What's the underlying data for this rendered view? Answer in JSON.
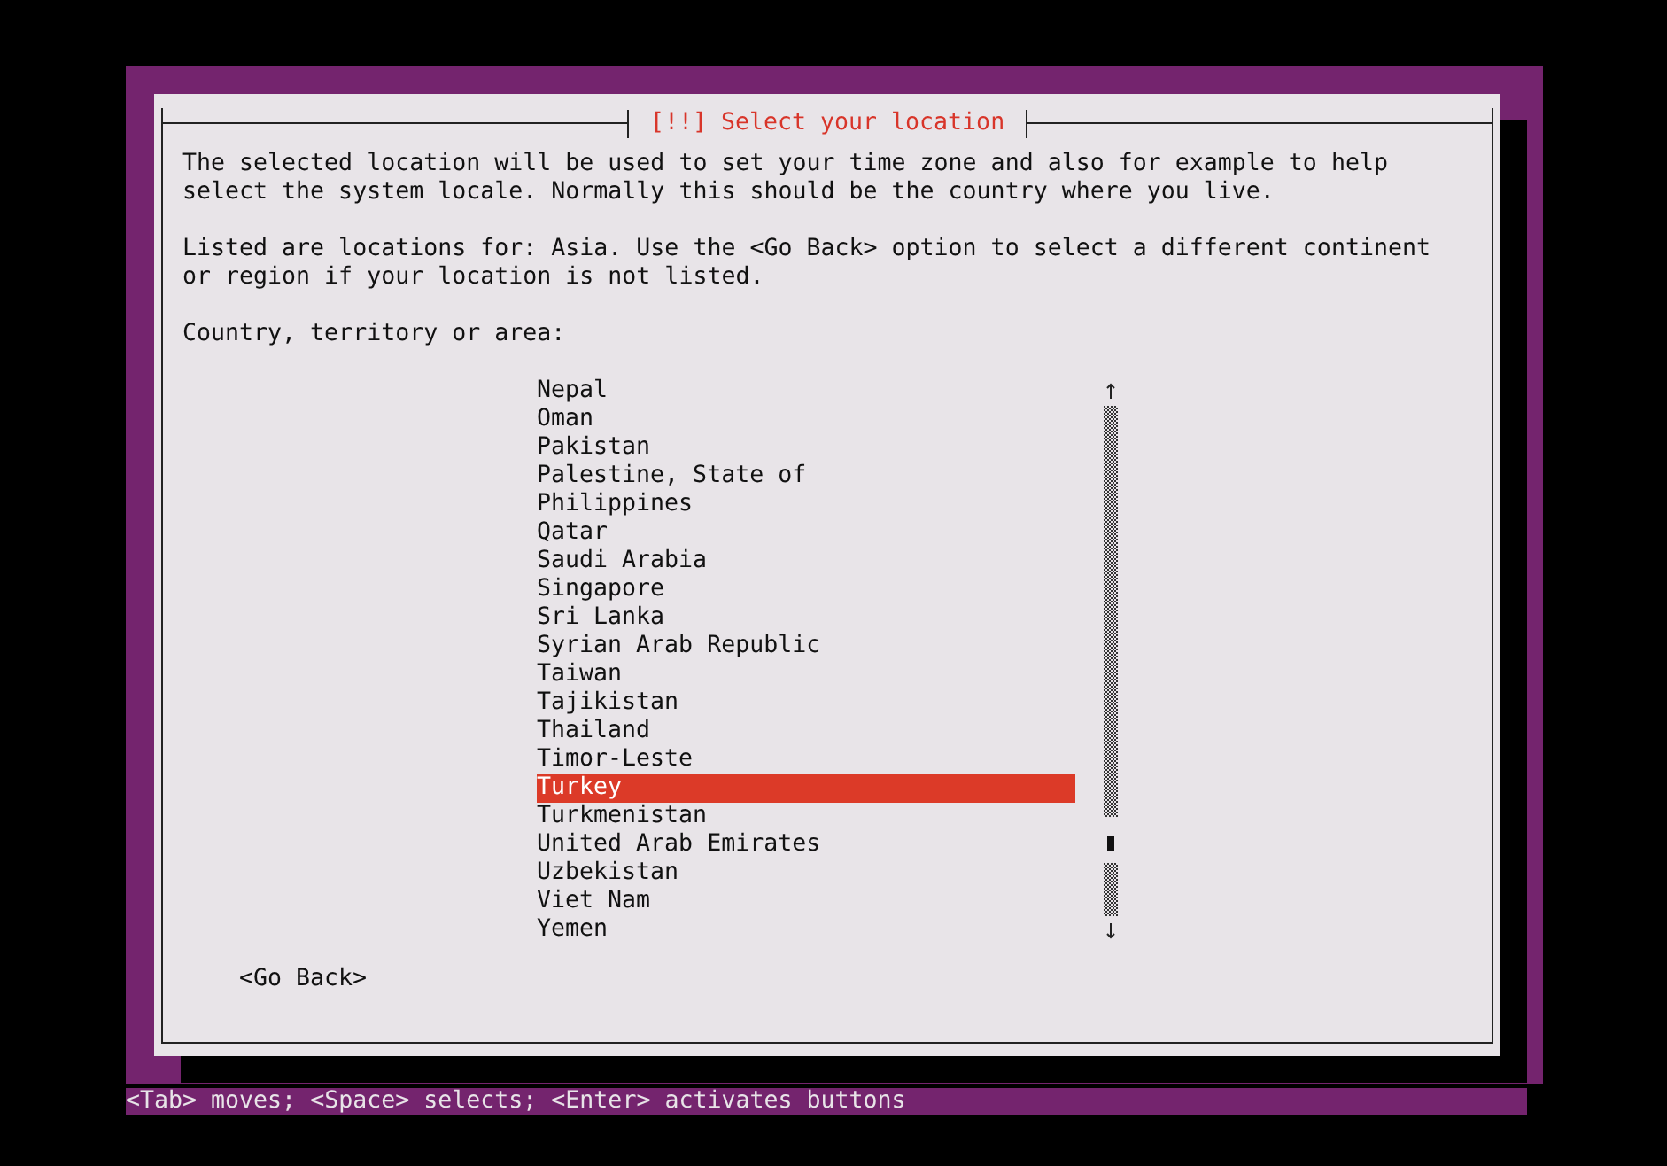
{
  "dialog": {
    "title": "[!!] Select your location",
    "paragraphs": [
      "The selected location will be used to set your time zone and also for example to help select the system locale. Normally this should be the country where you live.",
      "Listed are locations for: Asia. Use the <Go Back> option to select a different continent or region if your location is not listed."
    ],
    "list_label": "Country, territory or area:",
    "items": [
      {
        "label": "Nepal",
        "selected": false
      },
      {
        "label": "Oman",
        "selected": false
      },
      {
        "label": "Pakistan",
        "selected": false
      },
      {
        "label": "Palestine, State of",
        "selected": false
      },
      {
        "label": "Philippines",
        "selected": false
      },
      {
        "label": "Qatar",
        "selected": false
      },
      {
        "label": "Saudi Arabia",
        "selected": false
      },
      {
        "label": "Singapore",
        "selected": false
      },
      {
        "label": "Sri Lanka",
        "selected": false
      },
      {
        "label": "Syrian Arab Republic",
        "selected": false
      },
      {
        "label": "Taiwan",
        "selected": false
      },
      {
        "label": "Tajikistan",
        "selected": false
      },
      {
        "label": "Thailand",
        "selected": false
      },
      {
        "label": "Timor-Leste",
        "selected": false
      },
      {
        "label": "Turkey",
        "selected": true
      },
      {
        "label": "Turkmenistan",
        "selected": false
      },
      {
        "label": "United Arab Emirates",
        "selected": false
      },
      {
        "label": "Uzbekistan",
        "selected": false
      },
      {
        "label": "Viet Nam",
        "selected": false
      },
      {
        "label": "Yemen",
        "selected": false
      }
    ],
    "buttons": [
      "<Go Back>"
    ]
  },
  "status_bar": "<Tab> moves; <Space> selects; <Enter> activates buttons"
}
